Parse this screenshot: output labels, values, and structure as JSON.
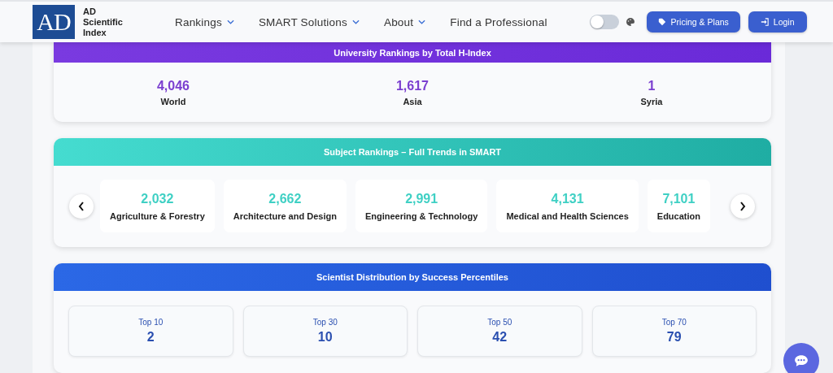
{
  "header": {
    "logo": {
      "mark": "AD",
      "lines": [
        "AD",
        "Scientific",
        "Index"
      ]
    },
    "nav": [
      {
        "label": "Rankings",
        "dropdown": true
      },
      {
        "label": "SMART Solutions",
        "dropdown": true
      },
      {
        "label": "About",
        "dropdown": true
      },
      {
        "label": "Find a Professional",
        "dropdown": false
      }
    ],
    "theme_toggle": {
      "on": false
    },
    "buttons": [
      {
        "label": "Pricing & Plans",
        "kind": "tag"
      },
      {
        "label": "Login",
        "kind": "login"
      }
    ]
  },
  "university_rankings": {
    "title": "University Rankings by Total H-Index",
    "stats": [
      {
        "value": "4,046",
        "label": "World"
      },
      {
        "value": "1,617",
        "label": "Asia"
      },
      {
        "value": "1",
        "label": "Syria"
      }
    ]
  },
  "subject_rankings": {
    "title": "Subject Rankings – Full Trends in SMART",
    "items": [
      {
        "value": "2,032",
        "label": "Agriculture & Forestry"
      },
      {
        "value": "2,662",
        "label": "Architecture and Design"
      },
      {
        "value": "2,991",
        "label": "Engineering & Technology"
      },
      {
        "value": "4,131",
        "label": "Medical and Health Sciences"
      },
      {
        "value": "7,101",
        "label": "Education"
      }
    ]
  },
  "percentiles": {
    "title": "Scientist Distribution by Success Percentiles",
    "items": [
      {
        "label": "Top 10",
        "value": "2"
      },
      {
        "label": "Top 30",
        "value": "10"
      },
      {
        "label": "Top 50",
        "value": "42"
      },
      {
        "label": "Top 70",
        "value": "79"
      }
    ]
  }
}
